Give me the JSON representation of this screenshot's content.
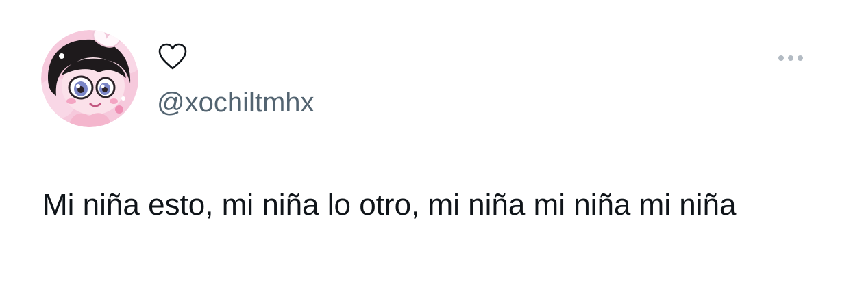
{
  "tweet": {
    "display_name_icon": "heart-outline-icon",
    "handle": "@xochiltmhx",
    "text": "Mi niña esto, mi niña lo otro, mi niña mi niña mi niña",
    "more_icon": "more-horizontal-icon",
    "avatar_icon": "cartoon-girl-avatar"
  },
  "colors": {
    "text_primary": "#0f1419",
    "text_secondary": "#536471",
    "more_dots": "#b3bbc3",
    "avatar_background": "#f6c9dc"
  }
}
